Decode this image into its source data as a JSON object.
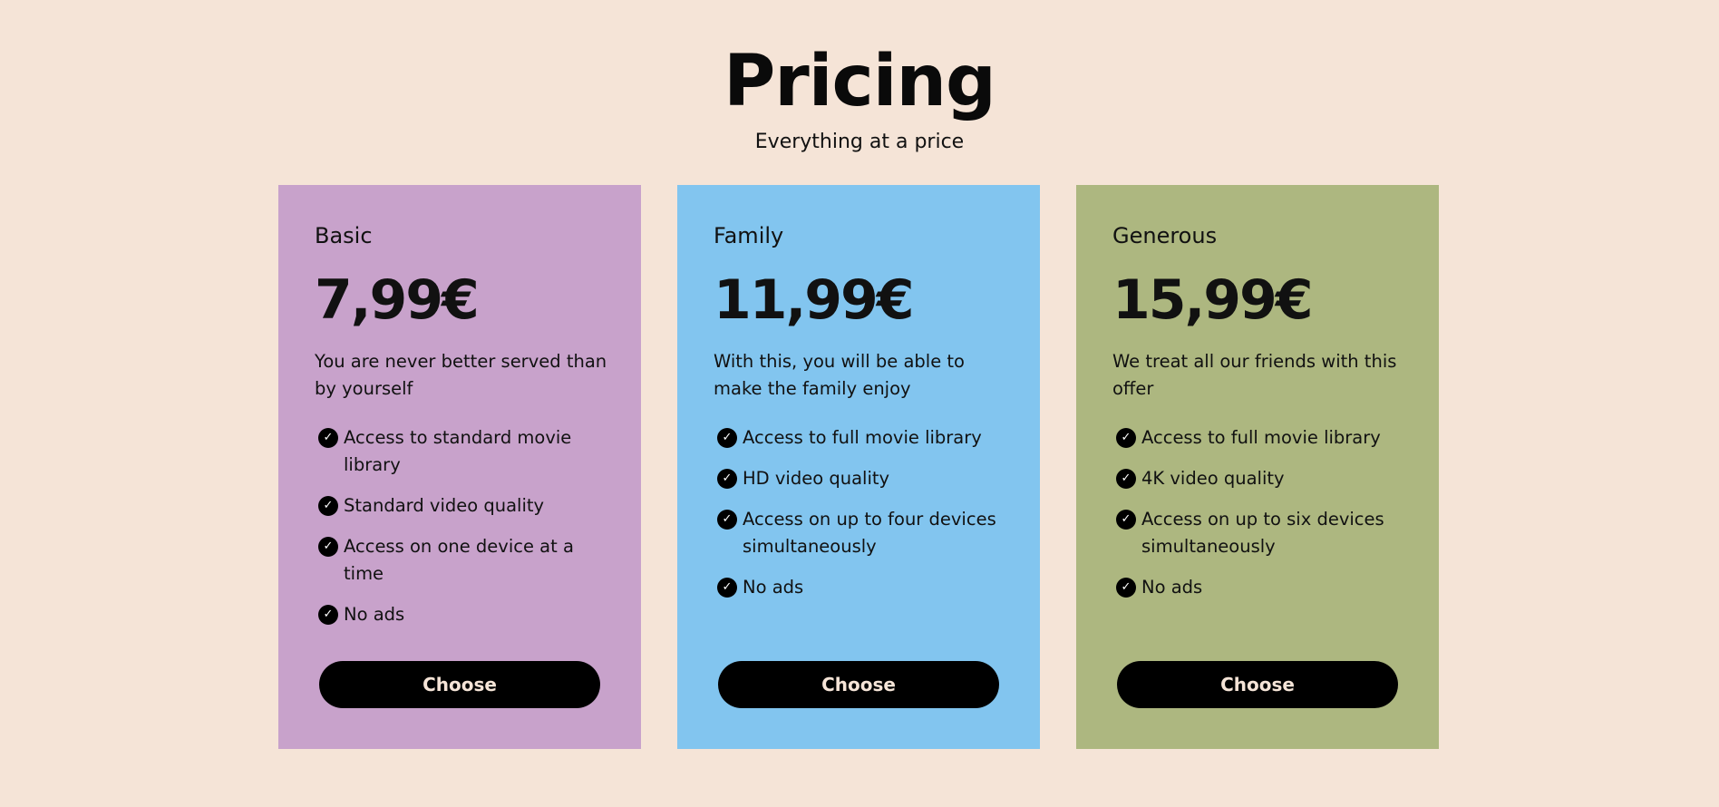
{
  "header": {
    "title": "Pricing",
    "subtitle": "Everything at a price"
  },
  "plans": [
    {
      "name": "Basic",
      "price": "7,99€",
      "description": "You are never better served than by yourself",
      "color": "#c8a2cb",
      "features": [
        "Access to standard movie library",
        "Standard video quality",
        "Access on one device at a time",
        "No ads"
      ],
      "button_label": "Choose"
    },
    {
      "name": "Family",
      "price": "11,99€",
      "description": "With this, you will be able to make the family enjoy",
      "color": "#82c5ef",
      "features": [
        "Access to full movie library",
        "HD video quality",
        "Access on up to four devices simultaneously",
        "No ads"
      ],
      "button_label": "Choose"
    },
    {
      "name": "Generous",
      "price": "15,99€",
      "description": "We treat all our friends with this offer",
      "color": "#adb780",
      "features": [
        "Access to full movie library",
        "4K video quality",
        "Access on up to six devices simultaneously",
        "No ads"
      ],
      "button_label": "Choose"
    }
  ],
  "icons": {
    "check": "check-circle-icon"
  },
  "colors": {
    "background": "#f5e4d7",
    "button": "#000000",
    "button_text": "#f5e4d7"
  }
}
